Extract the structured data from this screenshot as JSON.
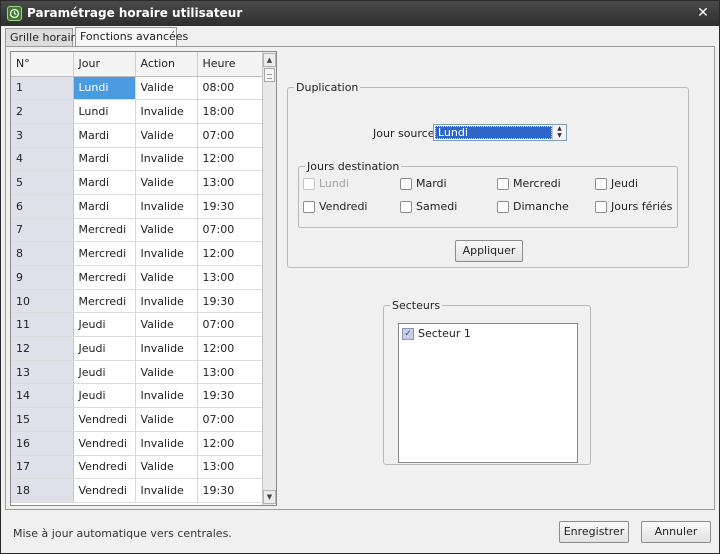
{
  "window": {
    "title": "Paramétrage horaire utilisateur",
    "close_glyph": "✕"
  },
  "tabs": [
    {
      "label": "Grille horaire"
    },
    {
      "label": "Fonctions avancées"
    }
  ],
  "table": {
    "headers": [
      "N°",
      "Jour",
      "Action",
      "Heure"
    ],
    "rows": [
      [
        "1",
        "Lundi",
        "Valide",
        "08:00"
      ],
      [
        "2",
        "Lundi",
        "Invalide",
        "18:00"
      ],
      [
        "3",
        "Mardi",
        "Valide",
        "07:00"
      ],
      [
        "4",
        "Mardi",
        "Invalide",
        "12:00"
      ],
      [
        "5",
        "Mardi",
        "Valide",
        "13:00"
      ],
      [
        "6",
        "Mardi",
        "Invalide",
        "19:30"
      ],
      [
        "7",
        "Mercredi",
        "Valide",
        "07:00"
      ],
      [
        "8",
        "Mercredi",
        "Invalide",
        "12:00"
      ],
      [
        "9",
        "Mercredi",
        "Valide",
        "13:00"
      ],
      [
        "10",
        "Mercredi",
        "Invalide",
        "19:30"
      ],
      [
        "11",
        "Jeudi",
        "Valide",
        "07:00"
      ],
      [
        "12",
        "Jeudi",
        "Invalide",
        "12:00"
      ],
      [
        "13",
        "Jeudi",
        "Valide",
        "13:00"
      ],
      [
        "14",
        "Jeudi",
        "Invalide",
        "19:30"
      ],
      [
        "15",
        "Vendredi",
        "Valide",
        "07:00"
      ],
      [
        "16",
        "Vendredi",
        "Invalide",
        "12:00"
      ],
      [
        "17",
        "Vendredi",
        "Valide",
        "13:00"
      ],
      [
        "18",
        "Vendredi",
        "Invalide",
        "19:30"
      ]
    ],
    "selected_cell": "Lundi"
  },
  "duplication": {
    "legend": "Duplication",
    "source_label": "Jour source",
    "source_value": "Lundi",
    "dest_legend": "Jours destination",
    "days": [
      {
        "label": "Lundi",
        "checked": false,
        "disabled": true
      },
      {
        "label": "Mardi",
        "checked": false,
        "disabled": false
      },
      {
        "label": "Mercredi",
        "checked": false,
        "disabled": false
      },
      {
        "label": "Jeudi",
        "checked": false,
        "disabled": false
      },
      {
        "label": "Vendredi",
        "checked": false,
        "disabled": false
      },
      {
        "label": "Samedi",
        "checked": false,
        "disabled": false
      },
      {
        "label": "Dimanche",
        "checked": false,
        "disabled": false
      },
      {
        "label": "Jours fériés",
        "checked": false,
        "disabled": false
      }
    ],
    "apply_label": "Appliquer"
  },
  "secteurs": {
    "legend": "Secteurs",
    "items": [
      {
        "label": "Secteur 1",
        "checked": true,
        "check_glyph": "✓"
      }
    ]
  },
  "footer": {
    "status": "Mise à jour automatique vers centrales.",
    "save_label": "Enregistrer",
    "cancel_label": "Annuler"
  },
  "colors": {
    "titlebar": "#3a3a3a",
    "selection": "#4b9be0",
    "combo_highlight": "#2d66cb",
    "row_number_bg": "#dfe0ea"
  }
}
